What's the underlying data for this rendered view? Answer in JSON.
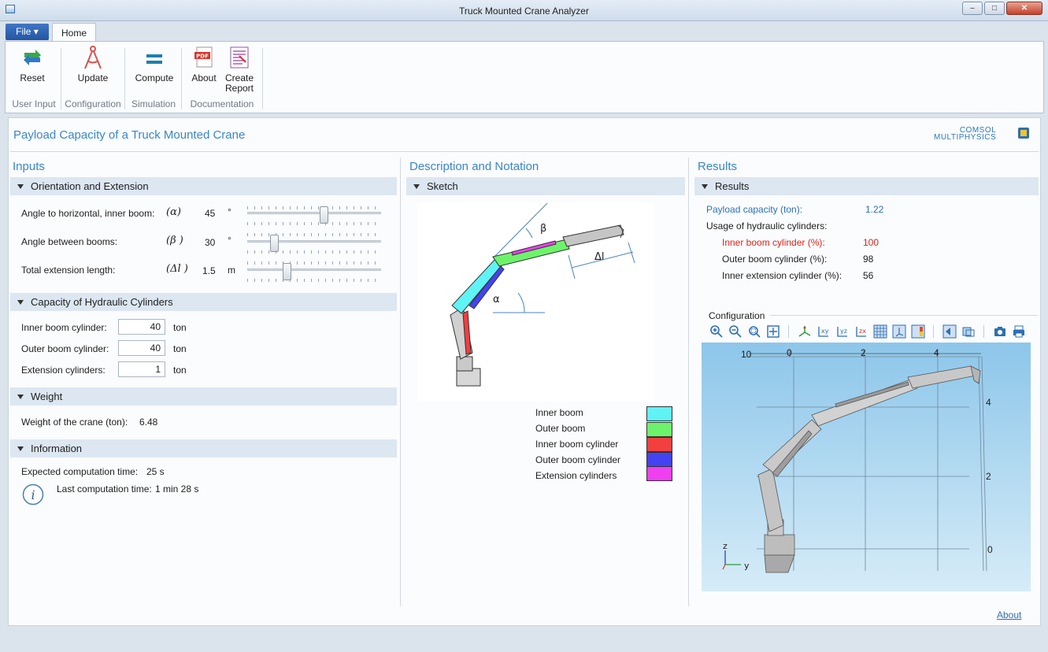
{
  "window": {
    "title": "Truck Mounted Crane Analyzer"
  },
  "ribbon": {
    "file_label": "File ▾",
    "home_tab": "Home",
    "buttons": {
      "reset": "Reset",
      "update": "Update",
      "compute": "Compute",
      "about": "About",
      "create_report_line1": "Create",
      "create_report_line2": "Report"
    },
    "groups": {
      "user_input": "User Input",
      "configuration": "Configuration",
      "simulation": "Simulation",
      "documentation": "Documentation"
    },
    "pdf_badge": "PDF"
  },
  "header": {
    "title": "Payload Capacity of a Truck Mounted Crane",
    "logo_line1": "COMSOL",
    "logo_line2": "MULTIPHYSICS"
  },
  "inputs": {
    "title": "Inputs",
    "orientation": {
      "header": "Orientation and Extension",
      "rows": [
        {
          "label": "Angle to horizontal, inner boom:",
          "symbol": "(α)",
          "value": "45",
          "unit": "°",
          "slider_fraction": 0.58
        },
        {
          "label": "Angle between booms:",
          "symbol": "(β )",
          "value": "30",
          "unit": "°",
          "slider_fraction": 0.18
        },
        {
          "label": "Total extension length:",
          "symbol": "(Δl )",
          "value": "1.5",
          "unit": "m",
          "slider_fraction": 0.28
        }
      ]
    },
    "capacity": {
      "header": "Capacity of Hydraulic Cylinders",
      "rows": [
        {
          "label": "Inner boom cylinder:",
          "value": "40",
          "unit": "ton"
        },
        {
          "label": "Outer boom cylinder:",
          "value": "40",
          "unit": "ton"
        },
        {
          "label": "Extension cylinders:",
          "value": "1",
          "unit": "ton"
        }
      ]
    },
    "weight": {
      "header": "Weight",
      "label": "Weight of the crane (ton):",
      "value": "6.48"
    },
    "information": {
      "header": "Information",
      "expected_label": "Expected computation time:",
      "expected_value": "25 s",
      "last_label": "Last computation time:",
      "last_value": "1 min 28 s"
    }
  },
  "description": {
    "title": "Description and Notation",
    "sketch_header": "Sketch",
    "sketch_labels": {
      "beta": "β",
      "alpha": "α",
      "delta_l": "Δl"
    },
    "legend": [
      {
        "label": "Inner boom",
        "color": "#5ff3f6"
      },
      {
        "label": "Outer boom",
        "color": "#6df36b"
      },
      {
        "label": "Inner boom cylinder",
        "color": "#f23f3f"
      },
      {
        "label": "Outer boom cylinder",
        "color": "#4443f2"
      },
      {
        "label": "Extension cylinders",
        "color": "#f03ef1"
      }
    ]
  },
  "results": {
    "title": "Results",
    "header": "Results",
    "payload_label": "Payload capacity (ton):",
    "payload_value": "1.22",
    "usage_label": "Usage of hydraulic cylinders:",
    "usage": [
      {
        "label": "Inner boom cylinder (%):",
        "value": "100",
        "highlight": true
      },
      {
        "label": "Outer boom cylinder (%):",
        "value": "98",
        "highlight": false
      },
      {
        "label": "Inner extension cylinder (%):",
        "value": "56",
        "highlight": false
      }
    ],
    "configuration_label": "Configuration",
    "axis_top": [
      "0",
      "2",
      "4"
    ],
    "axis_right": [
      "4",
      "2",
      "0"
    ],
    "corner_label": "10",
    "triad": {
      "z": "z",
      "y": "y"
    }
  },
  "footer": {
    "about_link": "About"
  },
  "colors": {
    "accent": "#3a86c8",
    "highlight": "#e0211b",
    "subheader": "#dce7f2"
  }
}
